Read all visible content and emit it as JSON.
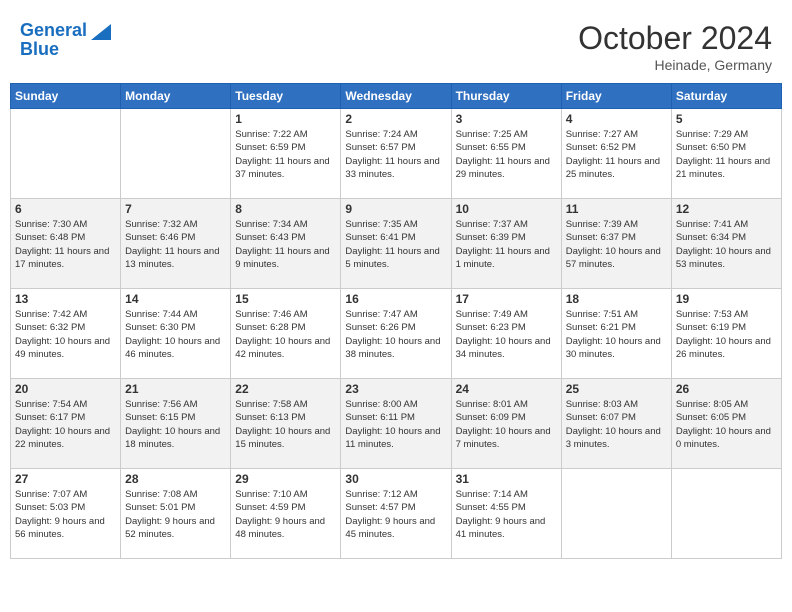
{
  "header": {
    "logo_line1": "General",
    "logo_line2": "Blue",
    "month": "October 2024",
    "location": "Heinade, Germany"
  },
  "days_of_week": [
    "Sunday",
    "Monday",
    "Tuesday",
    "Wednesday",
    "Thursday",
    "Friday",
    "Saturday"
  ],
  "weeks": [
    [
      {
        "num": "",
        "detail": ""
      },
      {
        "num": "",
        "detail": ""
      },
      {
        "num": "1",
        "detail": "Sunrise: 7:22 AM\nSunset: 6:59 PM\nDaylight: 11 hours and 37 minutes."
      },
      {
        "num": "2",
        "detail": "Sunrise: 7:24 AM\nSunset: 6:57 PM\nDaylight: 11 hours and 33 minutes."
      },
      {
        "num": "3",
        "detail": "Sunrise: 7:25 AM\nSunset: 6:55 PM\nDaylight: 11 hours and 29 minutes."
      },
      {
        "num": "4",
        "detail": "Sunrise: 7:27 AM\nSunset: 6:52 PM\nDaylight: 11 hours and 25 minutes."
      },
      {
        "num": "5",
        "detail": "Sunrise: 7:29 AM\nSunset: 6:50 PM\nDaylight: 11 hours and 21 minutes."
      }
    ],
    [
      {
        "num": "6",
        "detail": "Sunrise: 7:30 AM\nSunset: 6:48 PM\nDaylight: 11 hours and 17 minutes."
      },
      {
        "num": "7",
        "detail": "Sunrise: 7:32 AM\nSunset: 6:46 PM\nDaylight: 11 hours and 13 minutes."
      },
      {
        "num": "8",
        "detail": "Sunrise: 7:34 AM\nSunset: 6:43 PM\nDaylight: 11 hours and 9 minutes."
      },
      {
        "num": "9",
        "detail": "Sunrise: 7:35 AM\nSunset: 6:41 PM\nDaylight: 11 hours and 5 minutes."
      },
      {
        "num": "10",
        "detail": "Sunrise: 7:37 AM\nSunset: 6:39 PM\nDaylight: 11 hours and 1 minute."
      },
      {
        "num": "11",
        "detail": "Sunrise: 7:39 AM\nSunset: 6:37 PM\nDaylight: 10 hours and 57 minutes."
      },
      {
        "num": "12",
        "detail": "Sunrise: 7:41 AM\nSunset: 6:34 PM\nDaylight: 10 hours and 53 minutes."
      }
    ],
    [
      {
        "num": "13",
        "detail": "Sunrise: 7:42 AM\nSunset: 6:32 PM\nDaylight: 10 hours and 49 minutes."
      },
      {
        "num": "14",
        "detail": "Sunrise: 7:44 AM\nSunset: 6:30 PM\nDaylight: 10 hours and 46 minutes."
      },
      {
        "num": "15",
        "detail": "Sunrise: 7:46 AM\nSunset: 6:28 PM\nDaylight: 10 hours and 42 minutes."
      },
      {
        "num": "16",
        "detail": "Sunrise: 7:47 AM\nSunset: 6:26 PM\nDaylight: 10 hours and 38 minutes."
      },
      {
        "num": "17",
        "detail": "Sunrise: 7:49 AM\nSunset: 6:23 PM\nDaylight: 10 hours and 34 minutes."
      },
      {
        "num": "18",
        "detail": "Sunrise: 7:51 AM\nSunset: 6:21 PM\nDaylight: 10 hours and 30 minutes."
      },
      {
        "num": "19",
        "detail": "Sunrise: 7:53 AM\nSunset: 6:19 PM\nDaylight: 10 hours and 26 minutes."
      }
    ],
    [
      {
        "num": "20",
        "detail": "Sunrise: 7:54 AM\nSunset: 6:17 PM\nDaylight: 10 hours and 22 minutes."
      },
      {
        "num": "21",
        "detail": "Sunrise: 7:56 AM\nSunset: 6:15 PM\nDaylight: 10 hours and 18 minutes."
      },
      {
        "num": "22",
        "detail": "Sunrise: 7:58 AM\nSunset: 6:13 PM\nDaylight: 10 hours and 15 minutes."
      },
      {
        "num": "23",
        "detail": "Sunrise: 8:00 AM\nSunset: 6:11 PM\nDaylight: 10 hours and 11 minutes."
      },
      {
        "num": "24",
        "detail": "Sunrise: 8:01 AM\nSunset: 6:09 PM\nDaylight: 10 hours and 7 minutes."
      },
      {
        "num": "25",
        "detail": "Sunrise: 8:03 AM\nSunset: 6:07 PM\nDaylight: 10 hours and 3 minutes."
      },
      {
        "num": "26",
        "detail": "Sunrise: 8:05 AM\nSunset: 6:05 PM\nDaylight: 10 hours and 0 minutes."
      }
    ],
    [
      {
        "num": "27",
        "detail": "Sunrise: 7:07 AM\nSunset: 5:03 PM\nDaylight: 9 hours and 56 minutes."
      },
      {
        "num": "28",
        "detail": "Sunrise: 7:08 AM\nSunset: 5:01 PM\nDaylight: 9 hours and 52 minutes."
      },
      {
        "num": "29",
        "detail": "Sunrise: 7:10 AM\nSunset: 4:59 PM\nDaylight: 9 hours and 48 minutes."
      },
      {
        "num": "30",
        "detail": "Sunrise: 7:12 AM\nSunset: 4:57 PM\nDaylight: 9 hours and 45 minutes."
      },
      {
        "num": "31",
        "detail": "Sunrise: 7:14 AM\nSunset: 4:55 PM\nDaylight: 9 hours and 41 minutes."
      },
      {
        "num": "",
        "detail": ""
      },
      {
        "num": "",
        "detail": ""
      }
    ]
  ]
}
